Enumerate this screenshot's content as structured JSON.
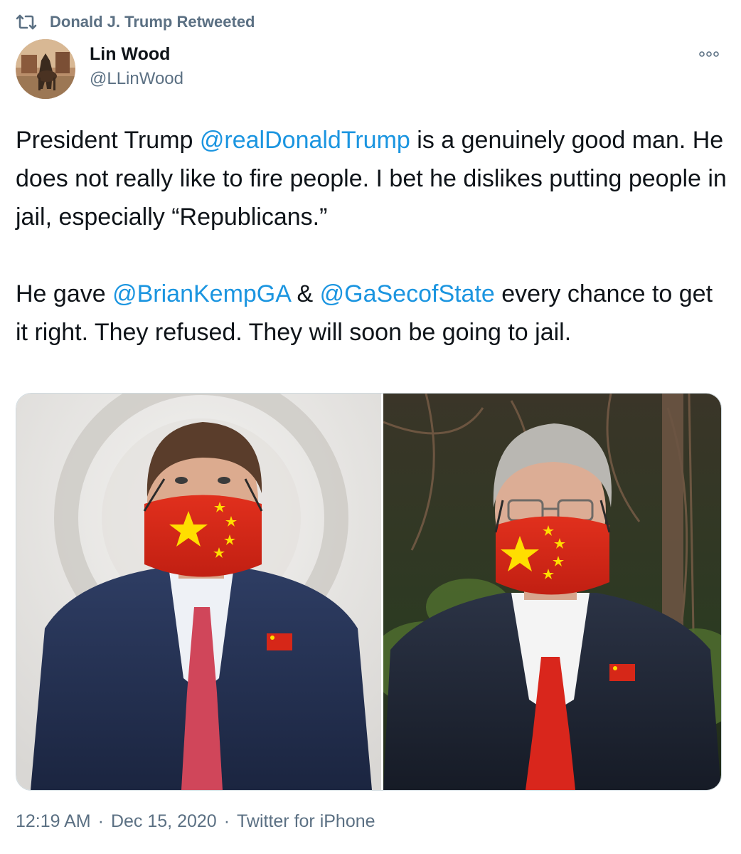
{
  "retweet": {
    "label": "Donald J. Trump Retweeted",
    "icon": "retweet-icon"
  },
  "author": {
    "name": "Lin Wood",
    "handle": "@LLinWood"
  },
  "more_icon": "more-icon",
  "tweet": {
    "p1": [
      {
        "text": "President Trump ",
        "mention": false
      },
      {
        "text": "@realDonaldTrump",
        "mention": true
      },
      {
        "text": " is a genuinely good man. He does not really like to fire people. I bet he dislikes putting people in jail, especially “Republicans.”",
        "mention": false
      }
    ],
    "p2": [
      {
        "text": "He gave ",
        "mention": false
      },
      {
        "text": "@BrianKempGA",
        "mention": true
      },
      {
        "text": " & ",
        "mention": false
      },
      {
        "text": "@GaSecofState",
        "mention": true
      },
      {
        "text": " every chance to get it right. They refused. They will soon be going to jail.",
        "mention": false
      }
    ]
  },
  "media": {
    "count": 2
  },
  "meta": {
    "time": "12:19 AM",
    "sep1": "·",
    "date": "Dec 15, 2020",
    "sep2": "·",
    "source": "Twitter for iPhone"
  },
  "colors": {
    "link": "#1b95e0",
    "secondary": "#5b7083",
    "text": "#0f1419",
    "mask_red": "#d62718",
    "star_yellow": "#ffde00"
  }
}
